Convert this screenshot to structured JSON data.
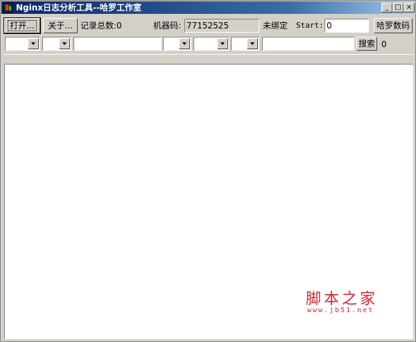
{
  "window": {
    "title": "Nginx日志分析工具--哈罗工作室",
    "controls": {
      "minimize": "_",
      "maximize": "□",
      "close": "×"
    }
  },
  "toolbar": {
    "open_label": "打开...",
    "about_label": "关于...",
    "record_count_label": "记录总数:0",
    "machine_code_label": "机器码:",
    "machine_code_value": "77152525",
    "bind_status": "未绑定",
    "start_label": "Start:",
    "start_value": "0",
    "brand_button_label": "哈罗数码"
  },
  "filters": {
    "search_label": "搜索",
    "result_count": "0"
  },
  "watermark": {
    "main": "脚本之家",
    "sub": "www.jb51.net"
  },
  "colors": {
    "title_bar": "#0a246a",
    "face": "#d4d0c8",
    "watermark": "#e0242b"
  }
}
